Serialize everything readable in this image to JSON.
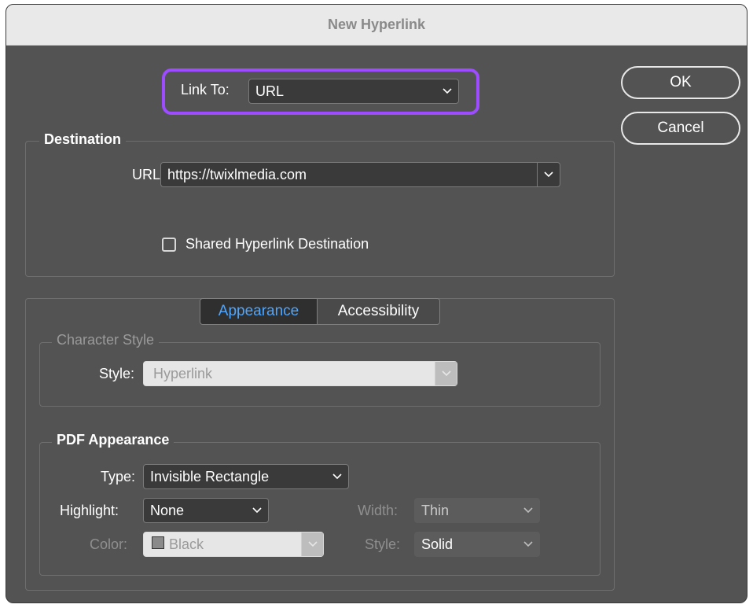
{
  "dialog": {
    "title": "New Hyperlink"
  },
  "link_to": {
    "label": "Link To:",
    "value": "URL"
  },
  "buttons": {
    "ok": "OK",
    "cancel": "Cancel"
  },
  "destination": {
    "title": "Destination",
    "url_label": "URL:",
    "url_value": "https://twixlmedia.com",
    "shared_label": "Shared Hyperlink Destination",
    "shared_checked": false
  },
  "tabs": {
    "appearance": "Appearance",
    "accessibility": "Accessibility",
    "active": "Appearance"
  },
  "character_style": {
    "title": "Character Style",
    "style_label": "Style:",
    "style_value": "Hyperlink"
  },
  "pdf_appearance": {
    "title": "PDF Appearance",
    "type_label": "Type:",
    "type_value": "Invisible Rectangle",
    "highlight_label": "Highlight:",
    "highlight_value": "None",
    "width_label": "Width:",
    "width_value": "Thin",
    "color_label": "Color:",
    "color_value": "Black",
    "style_label": "Style:",
    "style_value": "Solid"
  },
  "colors": {
    "accent": "#9d4dff",
    "active_tab": "#4ea6ff",
    "background": "#535353"
  }
}
